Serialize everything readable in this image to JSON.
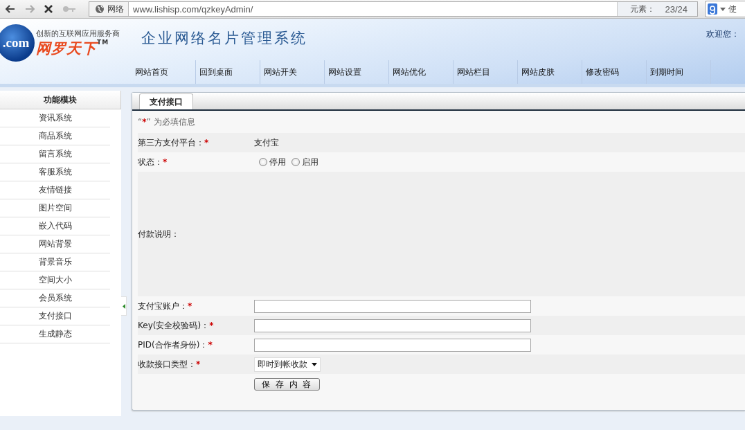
{
  "browser": {
    "site_label": "网络",
    "address": "www.lishisp.com/qzkeyAdmin/",
    "element_counter_label": "元素：",
    "element_counter": "23/24",
    "search_partial": "使"
  },
  "header": {
    "slogan": "创新的互联网应用服务商",
    "brand": "网罗天下",
    "trademark": "TM",
    "logo_text": ".com",
    "title": "企业网络名片管理系统",
    "welcome": "欢迎您："
  },
  "nav": [
    "网站首页",
    "回到桌面",
    "网站开关",
    "网站设置",
    "网站优化",
    "网站栏目",
    "网站皮肤",
    "修改密码",
    "到期时间"
  ],
  "sidebar": {
    "title": "功能模块",
    "items": [
      {
        "label": "资讯系统",
        "selected": false
      },
      {
        "label": "商品系统",
        "selected": false
      },
      {
        "label": "留言系统",
        "selected": false
      },
      {
        "label": "客服系统",
        "selected": false
      },
      {
        "label": "友情链接",
        "selected": false
      },
      {
        "label": "图片空间",
        "selected": false
      },
      {
        "label": "嵌入代码",
        "selected": false
      },
      {
        "label": "网站背景",
        "selected": false
      },
      {
        "label": "背景音乐",
        "selected": false
      },
      {
        "label": "空间大小",
        "selected": false
      },
      {
        "label": "会员系统",
        "selected": false
      },
      {
        "label": "支付接口",
        "selected": false
      },
      {
        "label": "生成静态",
        "selected": false
      }
    ]
  },
  "tabs": [
    {
      "label": "支付接口",
      "selected": true
    }
  ],
  "hint": {
    "before": "“",
    "mark": "*",
    "after": "” 为必填信息"
  },
  "form": [
    {
      "kind": "text",
      "label": "第三方支付平台：",
      "mark": "*",
      "value": "支付宝"
    },
    {
      "kind": "radio",
      "label": "状态：",
      "mark": "*",
      "options": [
        {
          "label": "停用",
          "selected": false
        },
        {
          "label": "启用",
          "selected": false
        }
      ]
    },
    {
      "kind": "area",
      "label": "付款说明："
    },
    {
      "kind": "input",
      "label": "支付宝账户：",
      "mark": "*"
    },
    {
      "kind": "input",
      "label": "Key(安全校验码)：",
      "mark": "*"
    },
    {
      "kind": "input",
      "label": "PID(合作者身份)：",
      "mark": "*"
    },
    {
      "kind": "select",
      "label": "收款接口类型：",
      "mark": "*",
      "value": "即时到帐收款"
    },
    {
      "kind": "button",
      "label": "保 存 内 容"
    }
  ]
}
